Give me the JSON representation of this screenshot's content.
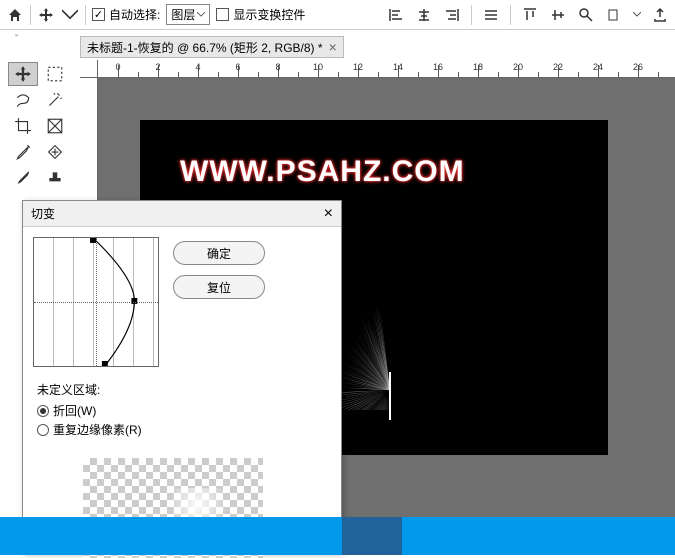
{
  "toolbar": {
    "auto_select_label": "自动选择:",
    "layer_label": "图层",
    "show_transform_label": "显示变换控件"
  },
  "tab": {
    "title": "未标题-1-恢复的 @ 66.7% (矩形 2, RGB/8) *"
  },
  "ruler": {
    "labels": [
      "0",
      "2",
      "4",
      "6",
      "8",
      "10",
      "12",
      "14",
      "16",
      "18",
      "20",
      "22",
      "24",
      "26"
    ]
  },
  "canvas": {
    "text": "WWW.PSAHZ.COM"
  },
  "dialog": {
    "title": "切变",
    "ok_label": "确定",
    "reset_label": "复位",
    "undef_area_title": "未定义区域:",
    "wrap_label": "折回(W)",
    "repeat_label": "重复边缘像素(R)"
  },
  "icons": {
    "home": "home-icon",
    "move": "move-icon",
    "chevron": "chevron-down-icon",
    "search": "search-icon",
    "share": "share-icon"
  }
}
